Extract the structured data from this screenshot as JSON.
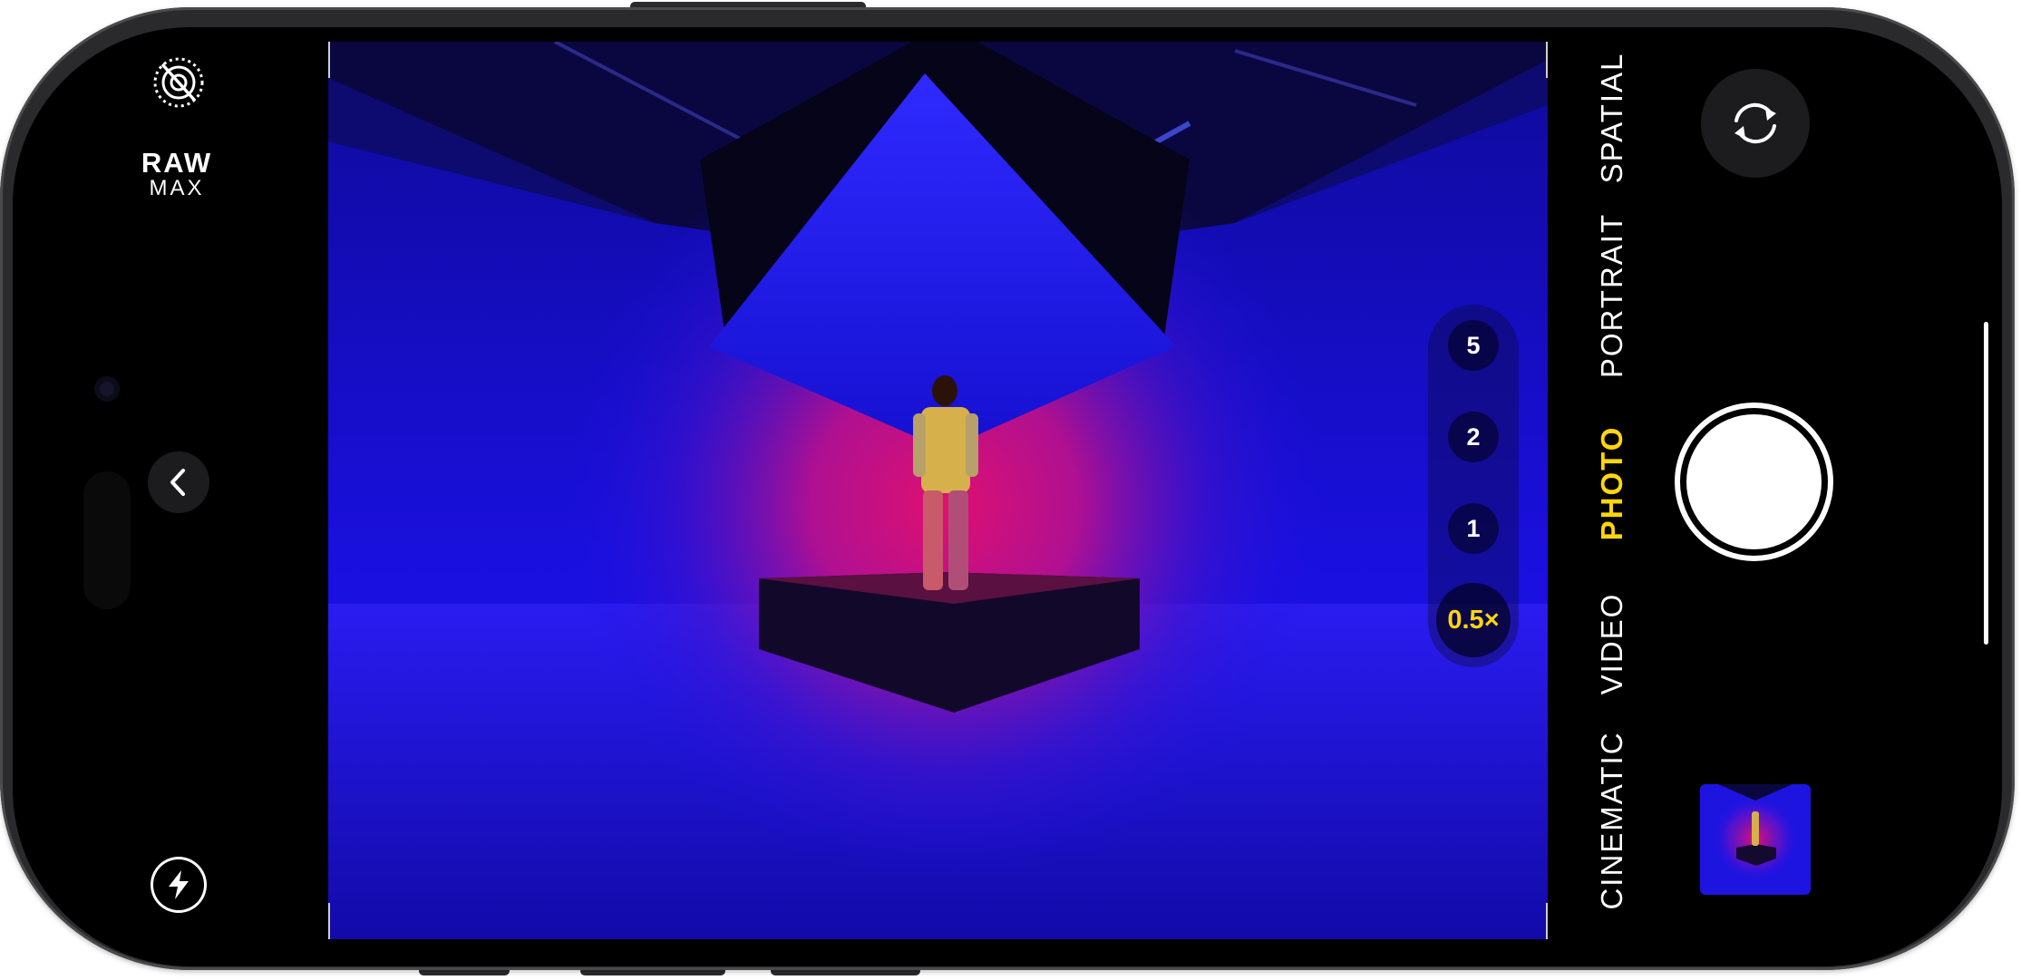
{
  "left_controls": {
    "live_photo_icon": "live-photo-off-icon",
    "raw_label": "RAW",
    "max_label": "MAX",
    "back_icon": "chevron-left-icon",
    "flash_icon": "flash-icon"
  },
  "zoom": {
    "options": [
      "5",
      "2",
      "1",
      "0.5×"
    ],
    "selected": "0.5×"
  },
  "modes": {
    "items": [
      "SPATIAL",
      "PORTRAIT",
      "PHOTO",
      "VIDEO",
      "CINEMATIC"
    ],
    "selected": "PHOTO"
  },
  "right_controls": {
    "switch_camera_icon": "switch-camera-icon",
    "shutter_icon": "shutter-button",
    "thumbnail": "last-photo-thumbnail"
  },
  "colors": {
    "accent_yellow": "#ffd60a",
    "scene_blue": "#1d10e8",
    "scene_magenta": "#e0106f",
    "control_bg": "#1c1c1e"
  }
}
